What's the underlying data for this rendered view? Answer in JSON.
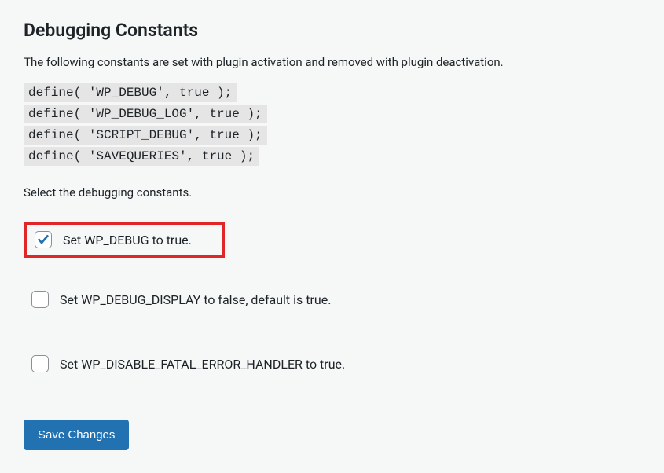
{
  "heading": "Debugging Constants",
  "intro": "The following constants are set with plugin activation and removed with plugin deactivation.",
  "code_lines": [
    "define( 'WP_DEBUG', true );",
    "define( 'WP_DEBUG_LOG', true );",
    "define( 'SCRIPT_DEBUG', true );",
    "define( 'SAVEQUERIES', true );"
  ],
  "select_prompt": "Select the debugging constants.",
  "options": [
    {
      "label": "Set WP_DEBUG to true.",
      "checked": true,
      "highlight": true
    },
    {
      "label": "Set WP_DEBUG_DISPLAY to false, default is true.",
      "checked": false,
      "highlight": false
    },
    {
      "label": "Set WP_DISABLE_FATAL_ERROR_HANDLER to true.",
      "checked": false,
      "highlight": false
    }
  ],
  "save_button": "Save Changes"
}
